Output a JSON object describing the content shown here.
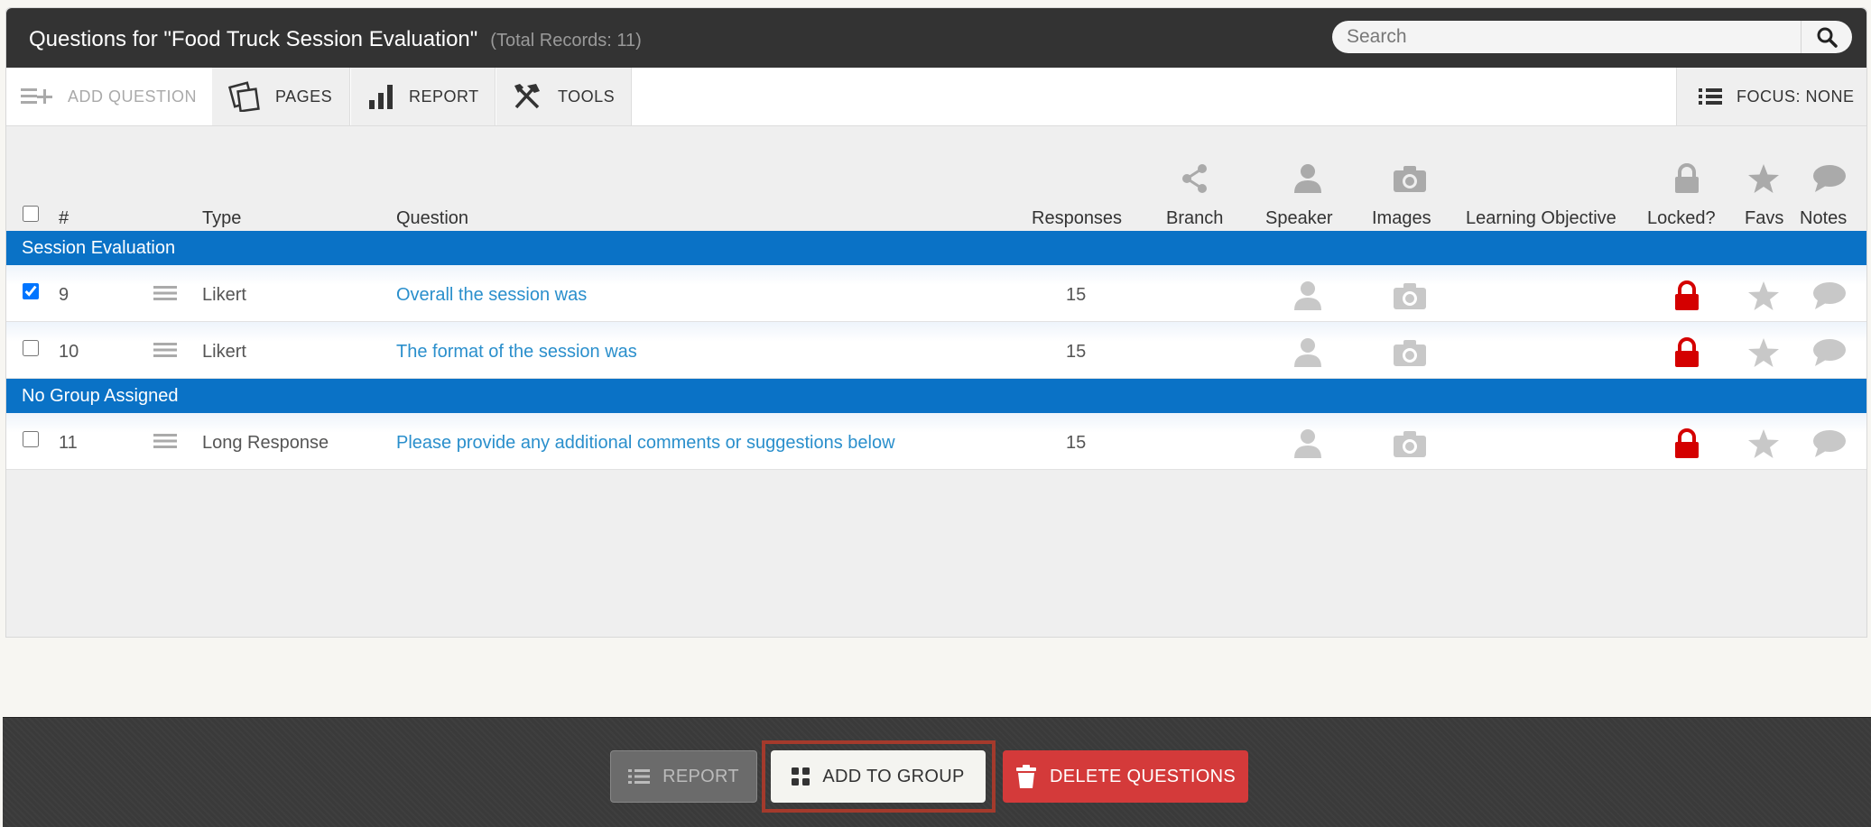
{
  "header": {
    "title": "Questions for \"Food Truck Session Evaluation\"",
    "total_records": "(Total Records: 11)",
    "search_placeholder": "Search"
  },
  "toolbar": {
    "add_question": "ADD QUESTION",
    "pages": "PAGES",
    "report": "REPORT",
    "tools": "TOOLS",
    "focus": "FOCUS: NONE"
  },
  "columns": {
    "num": "#",
    "type": "Type",
    "question": "Question",
    "responses": "Responses",
    "branch": "Branch",
    "speaker": "Speaker",
    "images": "Images",
    "learning_objective": "Learning Objective",
    "locked": "Locked?",
    "favs": "Favs",
    "notes": "Notes"
  },
  "groups": [
    {
      "name": "Session Evaluation",
      "rows": [
        {
          "checked": true,
          "num": "9",
          "type": "Likert",
          "question": "Overall the session was",
          "responses": "15"
        },
        {
          "checked": false,
          "num": "10",
          "type": "Likert",
          "question": "The format of the session was",
          "responses": "15"
        }
      ]
    },
    {
      "name": "No Group Assigned",
      "rows": [
        {
          "checked": false,
          "num": "11",
          "type": "Long Response",
          "question": "Please provide any additional comments or suggestions below",
          "responses": "15"
        }
      ]
    }
  ],
  "footer": {
    "report": "REPORT",
    "add_to_group": "ADD TO GROUP",
    "delete_questions": "DELETE QUESTIONS"
  },
  "colors": {
    "group_bar": "#0a72c6",
    "link": "#2a8fcc",
    "locked": "#d40000",
    "delete": "#d43a3a"
  }
}
